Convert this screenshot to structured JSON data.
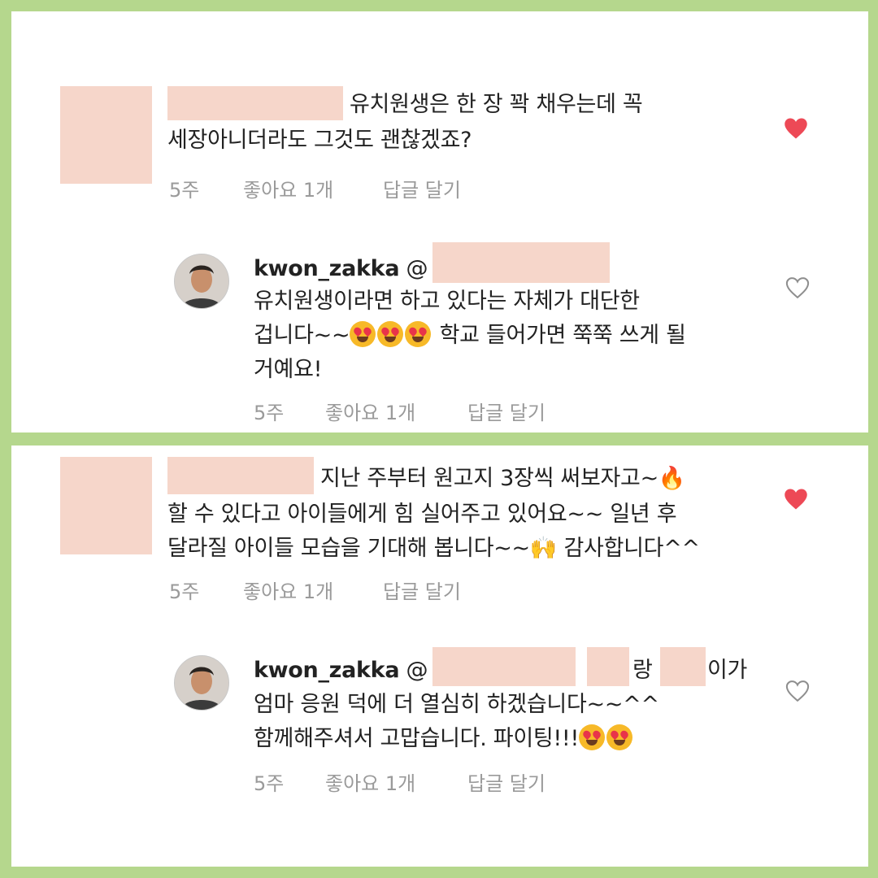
{
  "comments": [
    {
      "text_line1": "유치원생은 한 장 꽉 채우는데 꼭",
      "text_line2": "세장아니더라도 그것도 괜찮겠죠?",
      "time": "5주",
      "likes": "좋아요 1개",
      "reply": "답글 달기",
      "liked": true,
      "reply_item": {
        "username": "kwon_zakka",
        "mention": "@",
        "line1": "유치원생이라면 하고 있다는 자체가 대단한",
        "line2a": "겁니다~~",
        "line2b": " 학교 들어가면 쭉쭉 쓰게 될",
        "line3": "거예요!",
        "time": "5주",
        "likes": "좋아요 1개",
        "reply": "답글 달기"
      }
    },
    {
      "text_line1": "지난 주부터 원고지 3장씩 써보자고~",
      "line1_emoji": "🔥",
      "text_line2": "할 수 있다고 아이들에게 힘 실어주고 있어요~~ 일년 후",
      "text_line3a": "달라질 아이들 모습을 기대해 봅니다~~",
      "line3_emoji": "🙌",
      "text_line3b": " 감사합니다^^",
      "time": "5주",
      "likes": "좋아요 1개",
      "reply": "답글 달기",
      "liked": true,
      "reply_item": {
        "username": "kwon_zakka",
        "mention": "@",
        "mention_tail_1": "랑",
        "mention_tail_2": "이가",
        "line2": "엄마 응원 덕에 더 열심히 하겠습니다~~^^",
        "line3": "함께해주셔서 고맙습니다. 파이팅!!!",
        "time": "5주",
        "likes": "좋아요 1개",
        "reply": "답글 달기"
      }
    }
  ],
  "icons": {
    "liked_heart": "heart-filled-icon",
    "unliked_heart": "heart-outline-icon",
    "heart_color": "#ed4956"
  }
}
